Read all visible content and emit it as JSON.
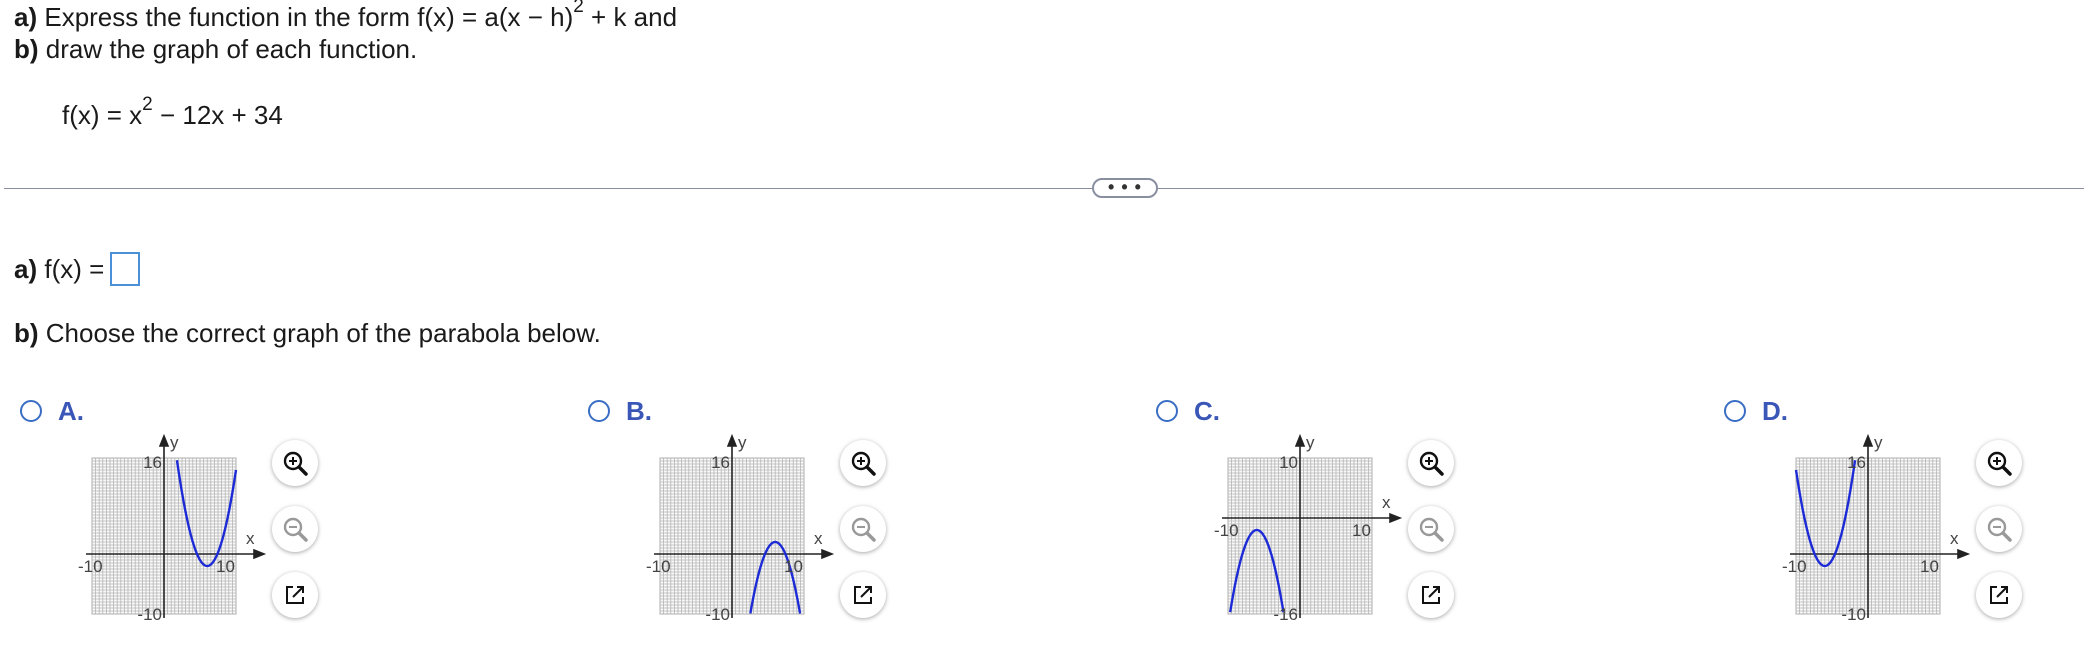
{
  "question": {
    "line1_prefix": "a)",
    "line1_text": " Express the function in the form f(x) = a(x − h)",
    "line1_exp": "2",
    "line1_suffix": " + k and",
    "line2_prefix": "b)",
    "line2_text": " draw the graph of each function.",
    "function_base": "f(x) = x",
    "function_exp": "2",
    "function_rest": " − 12x + 34",
    "ellipsis": "• • •"
  },
  "part_a": {
    "prefix": "a)",
    "label": " f(x) ="
  },
  "part_b": {
    "prefix": "b)",
    "text": " Choose the correct graph of the parabola below."
  },
  "options": [
    {
      "letter": "A.",
      "y_max": "16",
      "y_min": "-10",
      "x_min": "-10",
      "x_max": "10",
      "x_label": "x",
      "y_label": "y"
    },
    {
      "letter": "B.",
      "y_max": "16",
      "y_min": "-10",
      "x_min": "-10",
      "x_max": "10",
      "x_label": "x",
      "y_label": "y"
    },
    {
      "letter": "C.",
      "y_max": "10",
      "y_min": "-16",
      "x_min": "-10",
      "x_max": "10",
      "x_label": "x",
      "y_label": "y"
    },
    {
      "letter": "D.",
      "y_max": "16",
      "y_min": "-10",
      "x_min": "-10",
      "x_max": "10",
      "x_label": "x",
      "y_label": "y"
    }
  ],
  "tools": {
    "zoom_in_icon": "zoom-in-icon",
    "zoom_out_icon": "zoom-out-icon",
    "popout_icon": "popout-icon"
  },
  "colors": {
    "curve": "#1d2bd6",
    "radio": "#3a6ec4",
    "answer_box": "#4a90d9"
  }
}
